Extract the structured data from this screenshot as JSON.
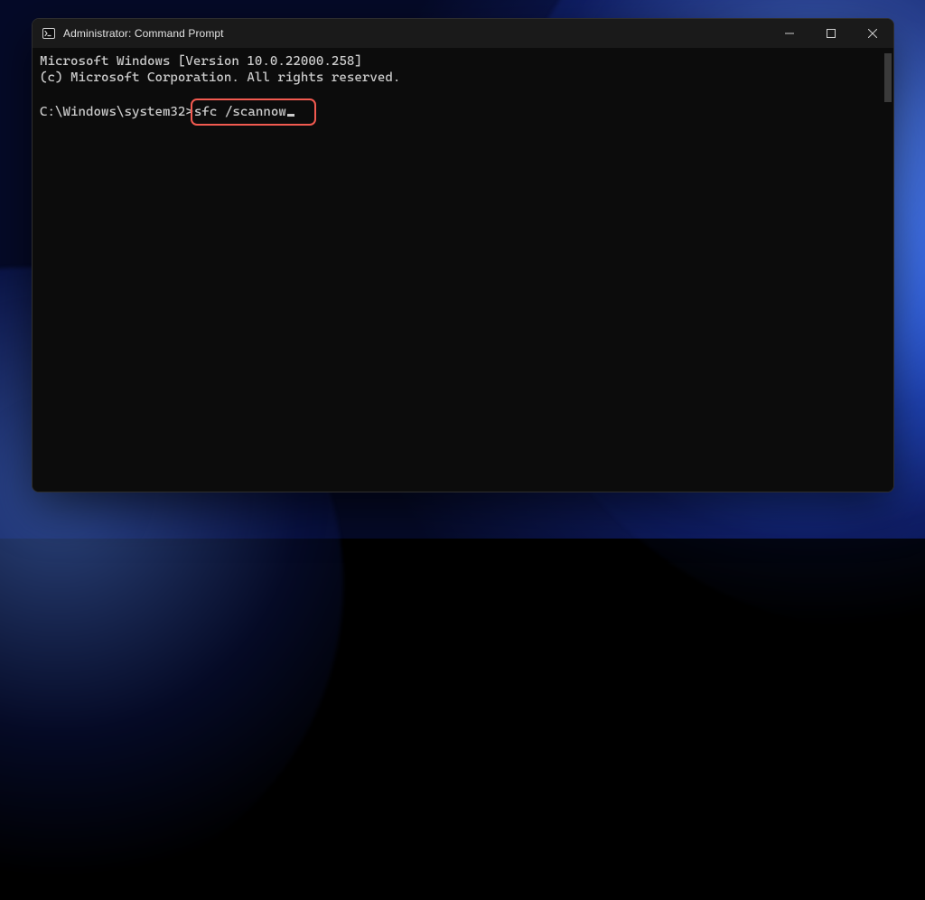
{
  "window": {
    "title": "Administrator: Command Prompt"
  },
  "terminal": {
    "line1": "Microsoft Windows [Version 10.0.22000.258]",
    "line2": "(c) Microsoft Corporation. All rights reserved.",
    "prompt": "C:\\Windows\\system32>",
    "command": "sfc /scannow"
  }
}
